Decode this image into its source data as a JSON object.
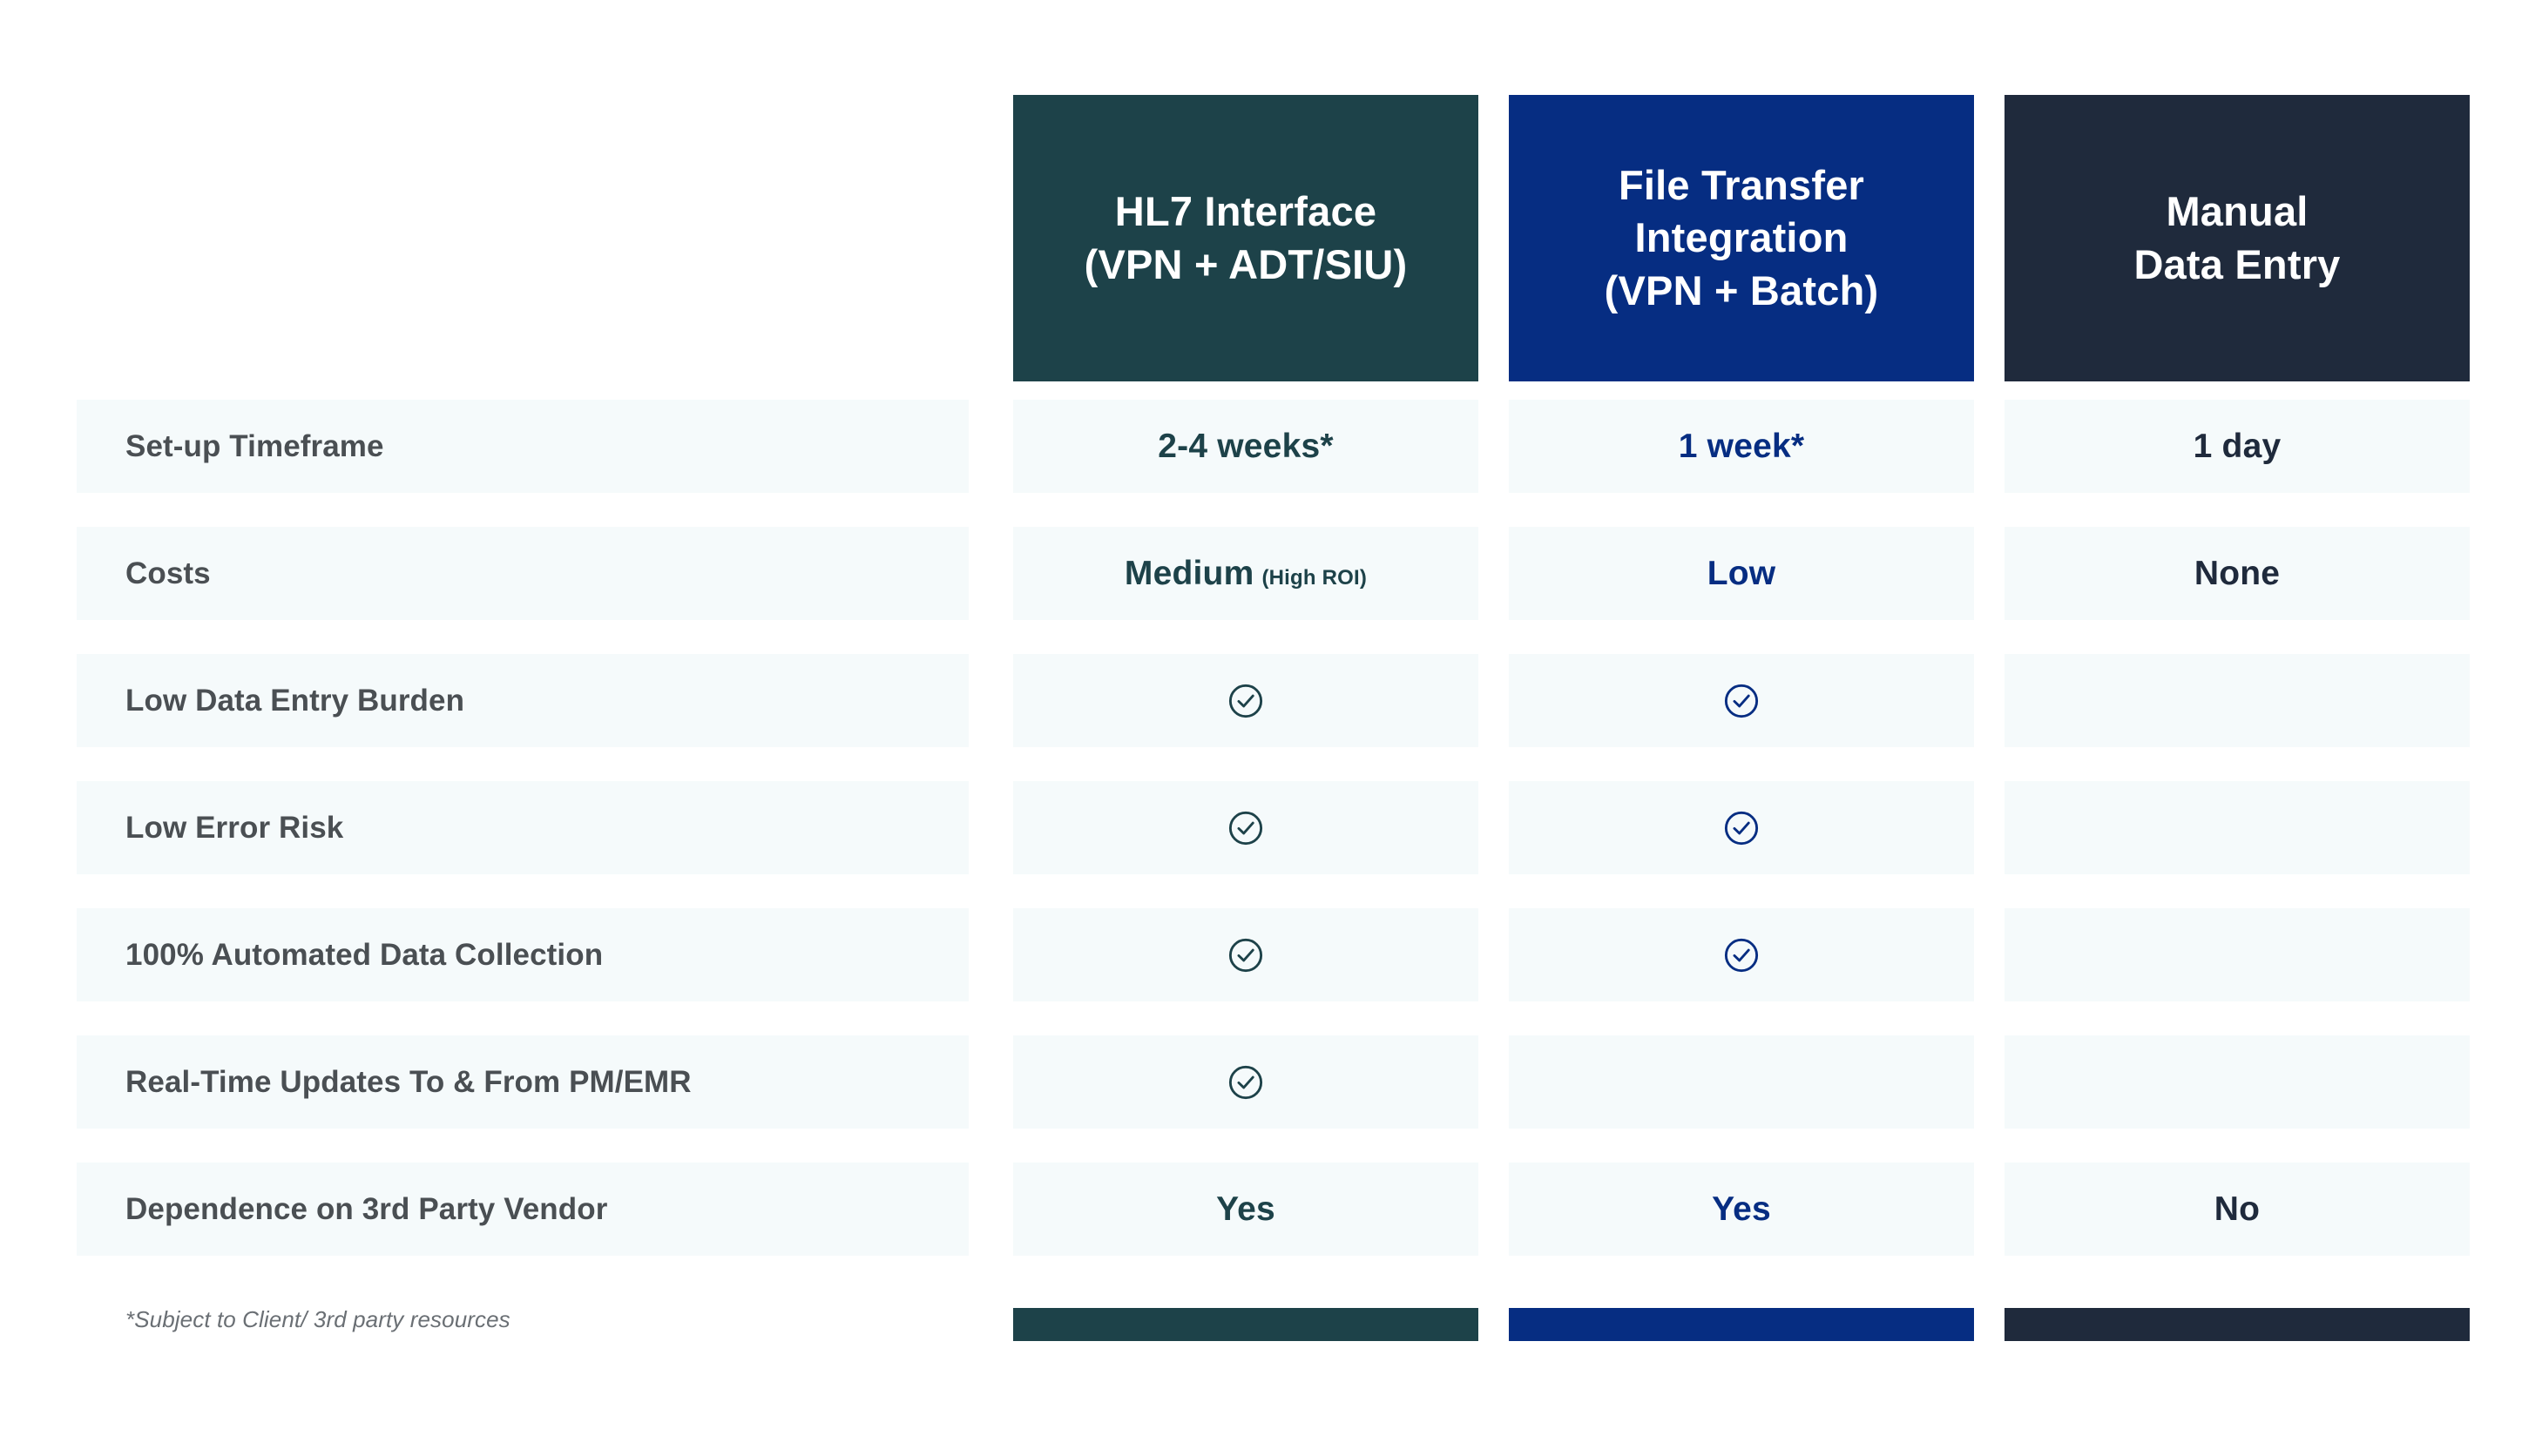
{
  "theme": {
    "row_background": "#f5fafb",
    "page_background": "#ffffff",
    "label_text_color": "#4a4f53",
    "footnote_color": "#6a6f74"
  },
  "columns": [
    {
      "id": "hl7-interface",
      "title": "HL7 Interface\n(VPN + ADT/SIU)",
      "color": "#1d4249"
    },
    {
      "id": "file-transfer-integration",
      "title": "File Transfer\nIntegration\n(VPN + Batch)",
      "color": "#062d82"
    },
    {
      "id": "manual-data-entry",
      "title": "Manual\nData Entry",
      "color": "#1f2a3c"
    }
  ],
  "rows": [
    {
      "label": "Set-up Timeframe",
      "cells": [
        {
          "kind": "text",
          "text": "2-4 weeks*"
        },
        {
          "kind": "text",
          "text": "1 week*"
        },
        {
          "kind": "text",
          "text": "1 day"
        }
      ]
    },
    {
      "label": "Costs",
      "cells": [
        {
          "kind": "text",
          "text": "Medium",
          "sub": "(High ROI)"
        },
        {
          "kind": "text",
          "text": "Low"
        },
        {
          "kind": "text",
          "text": "None"
        }
      ]
    },
    {
      "label": "Low Data Entry Burden",
      "cells": [
        {
          "kind": "check",
          "icon": "circle-check-icon"
        },
        {
          "kind": "check",
          "icon": "circle-check-icon"
        },
        {
          "kind": "empty"
        }
      ]
    },
    {
      "label": "Low Error Risk",
      "cells": [
        {
          "kind": "check",
          "icon": "circle-check-icon"
        },
        {
          "kind": "check",
          "icon": "circle-check-icon"
        },
        {
          "kind": "empty"
        }
      ]
    },
    {
      "label": "100% Automated Data Collection",
      "cells": [
        {
          "kind": "check",
          "icon": "circle-check-icon"
        },
        {
          "kind": "check",
          "icon": "circle-check-icon"
        },
        {
          "kind": "empty"
        }
      ]
    },
    {
      "label": "Real-Time Updates To & From PM/EMR",
      "cells": [
        {
          "kind": "check",
          "icon": "circle-check-icon"
        },
        {
          "kind": "empty"
        },
        {
          "kind": "empty"
        }
      ]
    },
    {
      "label": "Dependence on 3rd Party Vendor",
      "cells": [
        {
          "kind": "text",
          "text": "Yes"
        },
        {
          "kind": "text",
          "text": "Yes"
        },
        {
          "kind": "text",
          "text": "No"
        }
      ]
    }
  ],
  "footnote": "*Subject to Client/ 3rd party resources"
}
